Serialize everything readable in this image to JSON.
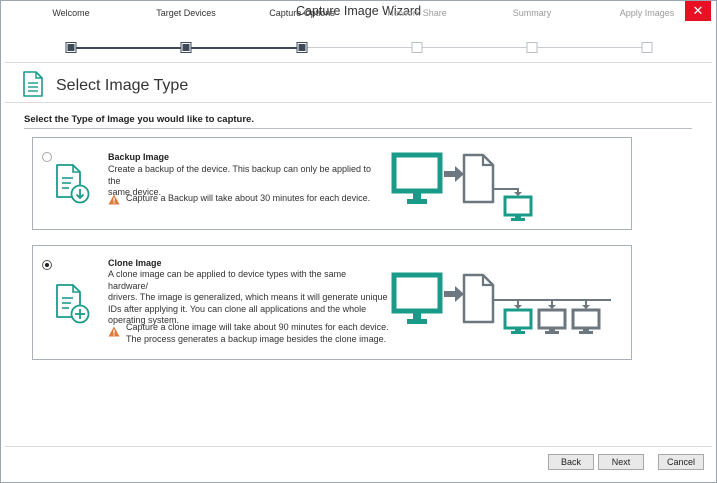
{
  "window": {
    "title": "Capture Image Wizard",
    "close_glyph": "✕"
  },
  "steps": [
    {
      "label": "Welcome",
      "state": "done"
    },
    {
      "label": "Target Devices",
      "state": "done"
    },
    {
      "label": "Capture Options",
      "state": "current"
    },
    {
      "label": "Network Share",
      "state": "pending"
    },
    {
      "label": "Summary",
      "state": "pending"
    },
    {
      "label": "Apply Images",
      "state": "pending"
    }
  ],
  "page": {
    "heading": "Select Image Type",
    "instruction": "Select the Type of Image you would like to capture."
  },
  "options": {
    "backup": {
      "title": "Backup Image",
      "desc_line1": "Create a backup of the device. This backup can only be applied to the",
      "desc_line2": "same device.",
      "warning": "Capture a Backup will take about 30 minutes for each device.",
      "selected": false
    },
    "clone": {
      "title": "Clone Image",
      "desc_line1": "A clone image can be applied to device types with the same hardware/",
      "desc_line2": "drivers. The image is generalized, which means it will generate unique",
      "desc_line3": "IDs after applying it. You can clone all applications and the whole",
      "desc_line4": "operating system.",
      "warning_line1": "Capture a clone image will take about 90 minutes for each device.",
      "warning_line2": "The process generates a backup image besides the clone image.",
      "selected": true
    }
  },
  "buttons": {
    "back": "Back",
    "next": "Next",
    "cancel": "Cancel"
  },
  "colors": {
    "accent": "#1a9b8a",
    "dark": "#3e4a57",
    "gray_device": "#6d7780",
    "warning": "#e07a3c",
    "close_red": "#e81123"
  },
  "icons": [
    "document-download-icon",
    "document-plus-icon",
    "warning-icon",
    "radio-icon",
    "monitor-icon",
    "file-icon",
    "arrow-icon"
  ]
}
